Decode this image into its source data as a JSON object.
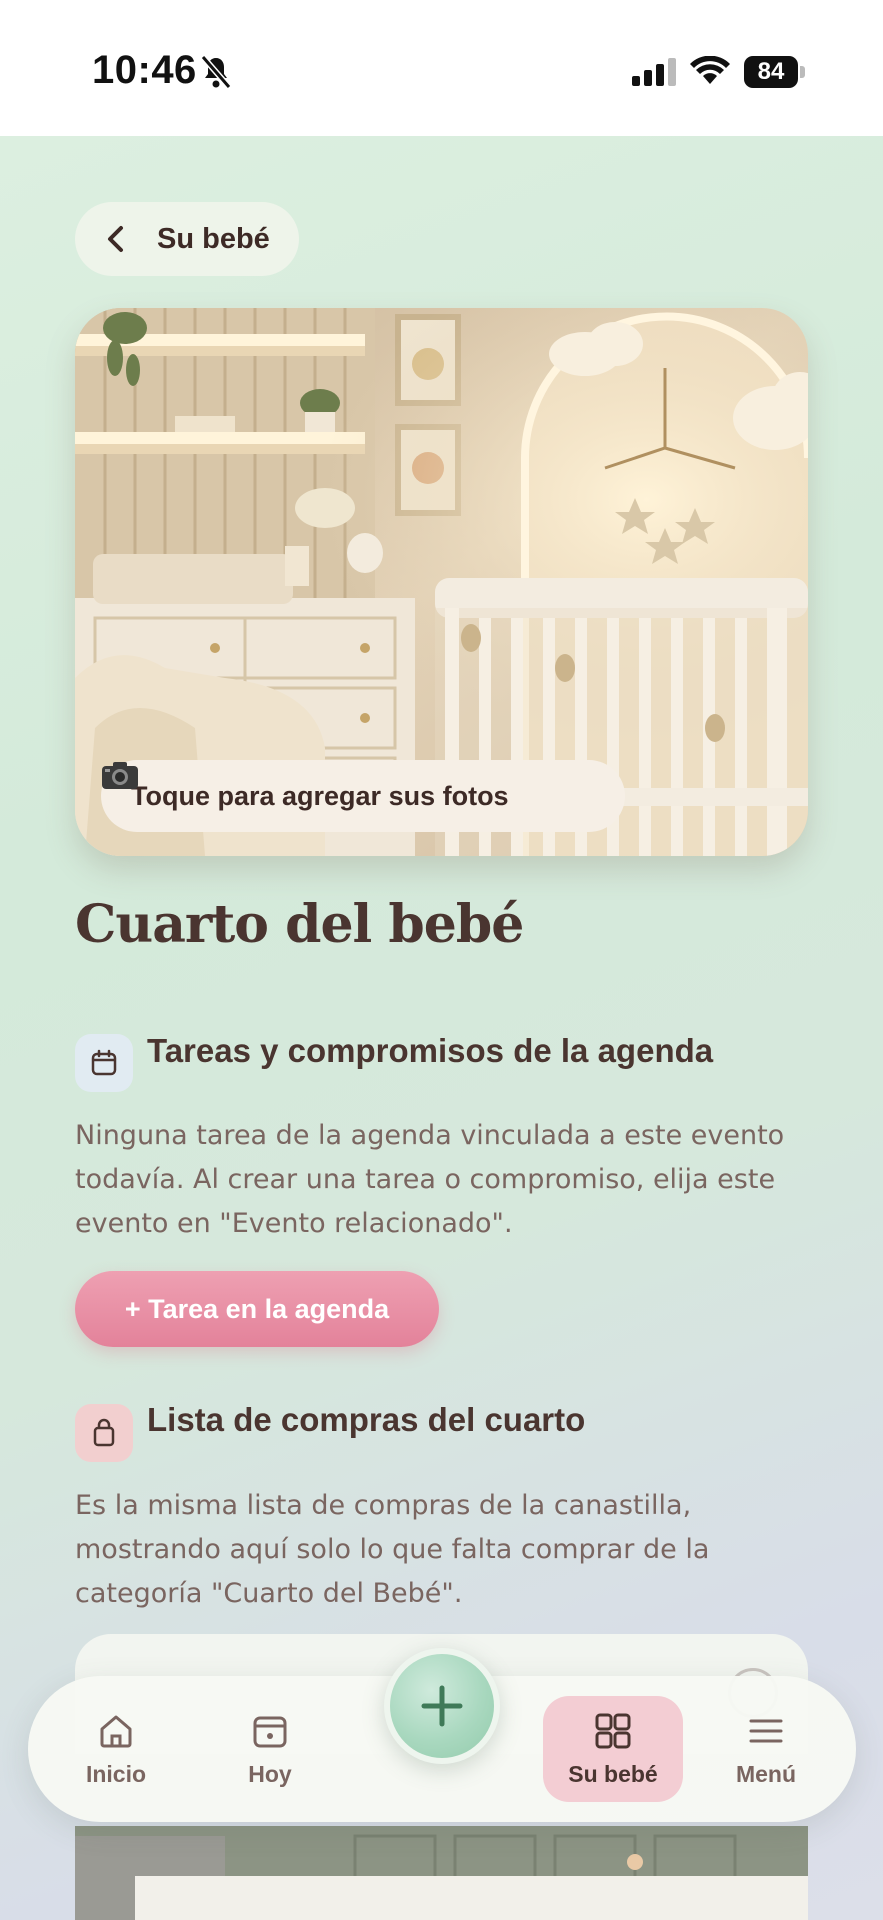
{
  "status_bar": {
    "time": "10:46",
    "battery": "84",
    "icons": [
      "bell-slash-icon",
      "signal-icon",
      "wifi-icon",
      "battery-icon"
    ]
  },
  "header": {
    "back_label": "Su bebé"
  },
  "hero": {
    "photo_prompt": "Toque para agregar sus fotos"
  },
  "page": {
    "title": "Cuarto del bebé"
  },
  "agenda_section": {
    "title": "Tareas y compromisos de la agenda",
    "description": "Ninguna tarea de la agenda vinculada a este evento todavía. Al crear una tarea o compromiso, elija este evento en \"Evento relacionado\".",
    "button_label": "+ Tarea en la agenda"
  },
  "shopping_section": {
    "title": "Lista de compras del cuarto",
    "description": "Es la misma lista de compras de la canastilla, mostrando aquí solo lo que falta comprar de la categoría \"Cuarto del Bebé\"."
  },
  "bottom_nav": {
    "items": [
      {
        "label": "Inicio",
        "icon": "home-icon"
      },
      {
        "label": "Hoy",
        "icon": "calendar-icon"
      },
      {
        "label": "Su bebé",
        "icon": "grid-icon",
        "active": true
      },
      {
        "label": "Menú",
        "icon": "menu-icon"
      }
    ],
    "fab_icon": "plus-icon"
  },
  "colors": {
    "accent_pink": "#e3829a",
    "accent_green": "#93cbac",
    "text_dark": "#4a3530",
    "text_muted": "#7a6560"
  }
}
